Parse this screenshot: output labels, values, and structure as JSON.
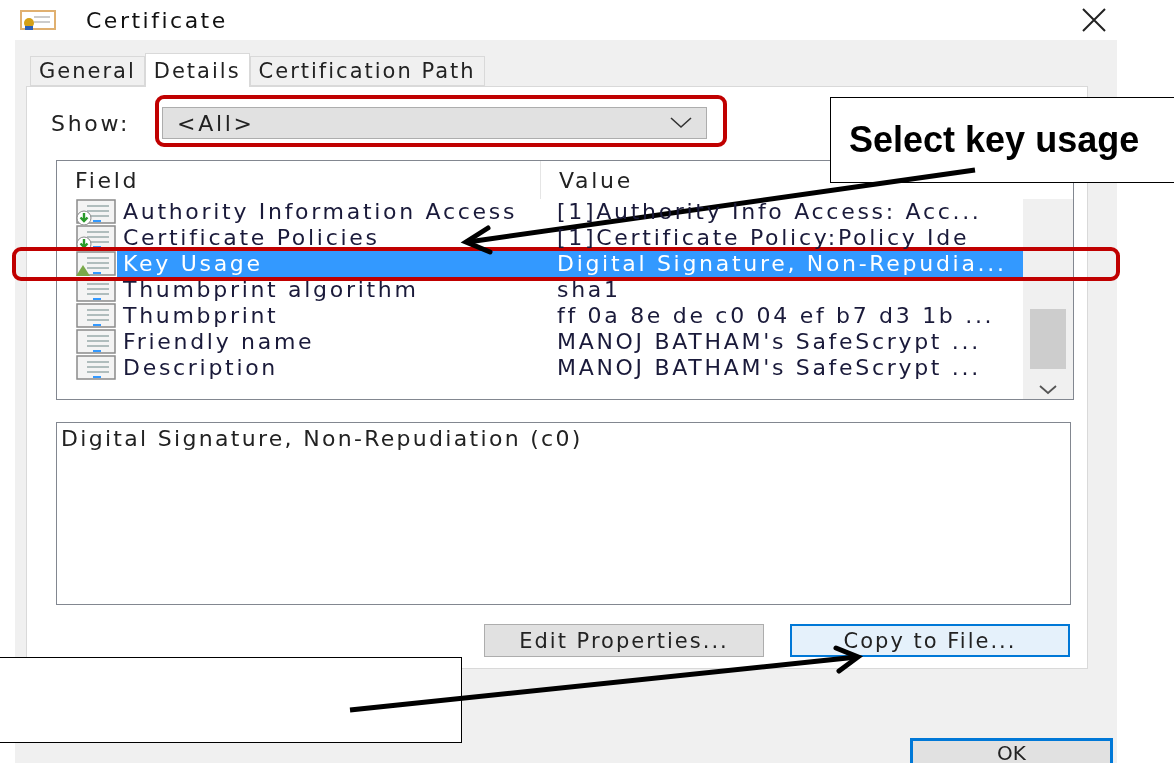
{
  "window": {
    "title": "Certificate"
  },
  "tabs": [
    {
      "label": "General",
      "selected": false
    },
    {
      "label": "Details",
      "selected": true
    },
    {
      "label": "Certification Path",
      "selected": false
    }
  ],
  "show": {
    "label": "Show:",
    "value": "<All>"
  },
  "table": {
    "columns": [
      "Field",
      "Value"
    ],
    "rows": [
      {
        "kind": "download",
        "field": "Authority Information Access",
        "value": "[1]Authority Info Access: Acc...",
        "selected": false
      },
      {
        "kind": "download",
        "field": "Certificate Policies",
        "value": "[1]Certificate Policy:Policy Ide",
        "selected": false
      },
      {
        "kind": "warning",
        "field": "Key Usage",
        "value": "Digital Signature, Non-Repudia...",
        "selected": true
      },
      {
        "kind": "plain",
        "field": "Thumbprint algorithm",
        "value": "sha1",
        "selected": false
      },
      {
        "kind": "plain",
        "field": "Thumbprint",
        "value": "ff 0a 8e de c0 04 ef b7 d3 1b ...",
        "selected": false
      },
      {
        "kind": "plain",
        "field": "Friendly name",
        "value": "MANOJ BATHAM's SafeScrypt ...",
        "selected": false
      },
      {
        "kind": "plain",
        "field": "Description",
        "value": "MANOJ BATHAM's SafeScrypt ...",
        "selected": false
      }
    ]
  },
  "detail": {
    "value": "Digital Signature, Non-Repudiation (c0)"
  },
  "buttons": [
    {
      "label": "Edit Properties...",
      "focused": false
    },
    {
      "label": "Copy to File...",
      "focused": true
    }
  ],
  "ok_button": {
    "label": "OK"
  },
  "callouts": [
    {
      "kind": "labeled",
      "text": "Select key usage"
    },
    {
      "kind": "blank"
    }
  ]
}
